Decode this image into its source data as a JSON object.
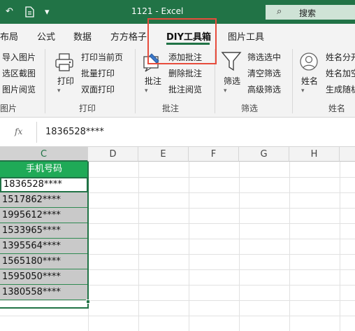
{
  "titlebar": {
    "title": "1121  -  Excel",
    "search_label": "搜索",
    "dropdown_glyph": "▾"
  },
  "tabs": [
    {
      "label": "布局"
    },
    {
      "label": "公式"
    },
    {
      "label": "数据"
    },
    {
      "label": "方方格子"
    },
    {
      "label": "DIY工具箱",
      "active": true
    },
    {
      "label": "图片工具"
    }
  ],
  "ribbon": {
    "group1": {
      "items": [
        "导入图片",
        "选区截图",
        "图片阅览"
      ],
      "label": "图片"
    },
    "print": {
      "big_label": "打印",
      "items": [
        "打印当前页",
        "批量打印",
        "双面打印"
      ],
      "label": "打印"
    },
    "comment": {
      "big_label": "批注",
      "items": [
        "添加批注",
        "删除批注",
        "批注阅览"
      ],
      "label": "批注"
    },
    "filter": {
      "big_label": "筛选",
      "items": [
        "筛选选中",
        "清空筛选",
        "高级筛选"
      ],
      "label": "筛选"
    },
    "name": {
      "big_label": "姓名",
      "items": [
        "姓名分开",
        "姓名加空",
        "生成随机"
      ],
      "label": "姓名"
    }
  },
  "formula_bar": {
    "fx": "fx",
    "value": "1836528****"
  },
  "columns": [
    "C",
    "D",
    "E",
    "F",
    "G",
    "H"
  ],
  "sheet": {
    "header": "手机号码",
    "rows": [
      "1836528****",
      "1517862****",
      "1995612****",
      "1533965****",
      "1395564****",
      "1565180****",
      "1595050****",
      "1380558****"
    ]
  },
  "colors": {
    "accent": "#217346",
    "header_fill": "#1faa57",
    "highlight": "#e74c3c"
  }
}
